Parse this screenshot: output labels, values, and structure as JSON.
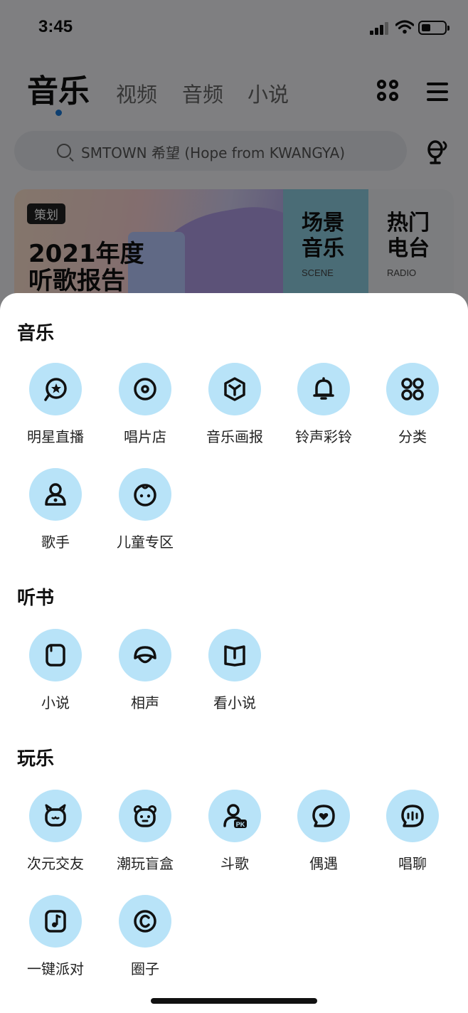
{
  "status_bar": {
    "time": "3:45"
  },
  "header": {
    "tabs": [
      {
        "label": "音乐",
        "active": true
      },
      {
        "label": "视频",
        "active": false
      },
      {
        "label": "音频",
        "active": false
      },
      {
        "label": "小说",
        "active": false
      }
    ]
  },
  "search": {
    "placeholder": "SMTOWN 希望 (Hope from KWANGYA)"
  },
  "banner": {
    "tag": "策划",
    "title": "2021年度听歌报告",
    "scene": {
      "title": "场景音乐",
      "subtitle": "SCENE"
    },
    "radio": {
      "title": "热门电台",
      "subtitle": "RADIO"
    }
  },
  "sheet": {
    "sections": [
      {
        "title": "音乐",
        "items": [
          {
            "label": "明星直播",
            "icon": "star-chat-icon"
          },
          {
            "label": "唱片店",
            "icon": "vinyl-record-icon"
          },
          {
            "label": "音乐画报",
            "icon": "cube-icon"
          },
          {
            "label": "铃声彩铃",
            "icon": "bell-icon"
          },
          {
            "label": "分类",
            "icon": "grid-circles-icon"
          },
          {
            "label": "歌手",
            "icon": "singer-icon"
          },
          {
            "label": "儿童专区",
            "icon": "baby-face-icon"
          }
        ]
      },
      {
        "title": "听书",
        "items": [
          {
            "label": "小说",
            "icon": "book-icon"
          },
          {
            "label": "相声",
            "icon": "fan-icon"
          },
          {
            "label": "看小说",
            "icon": "open-book-icon"
          }
        ]
      },
      {
        "title": "玩乐",
        "items": [
          {
            "label": "次元交友",
            "icon": "cat-face-icon"
          },
          {
            "label": "潮玩盲盒",
            "icon": "bear-face-icon"
          },
          {
            "label": "斗歌",
            "icon": "pk-user-icon"
          },
          {
            "label": "偶遇",
            "icon": "heart-bubble-icon"
          },
          {
            "label": "唱聊",
            "icon": "sound-bubble-icon"
          },
          {
            "label": "一键派对",
            "icon": "music-card-icon"
          },
          {
            "label": "圈子",
            "icon": "circle-c-icon"
          }
        ]
      }
    ]
  }
}
